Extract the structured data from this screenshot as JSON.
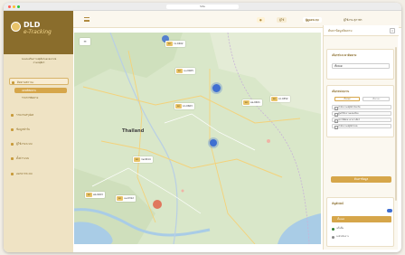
{
  "browser": {
    "address": "Site"
  },
  "brand": {
    "name": "DLD",
    "product": "e-Tracking"
  },
  "org": {
    "line1": "กองส่งเสริมการปศุสัตว์และสหกรณ์",
    "line2": "กรมปศุสัตว์"
  },
  "menu": [
    {
      "label": "ติดตามสถานะ",
      "active": true
    },
    {
      "label": "รายงานสรุปผล",
      "active": false
    },
    {
      "label": "ข้อมูลฟาร์ม",
      "active": false
    },
    {
      "label": "ผู้ใช้งานระบบ",
      "active": false
    },
    {
      "label": "ตั้งค่าระบบ",
      "active": false
    },
    {
      "label": "ออกจากระบบ",
      "active": false
    }
  ],
  "submenu": [
    {
      "label": "แผนที่ติดตาม",
      "active": true
    },
    {
      "label": "รายการติดตาม",
      "active": false
    }
  ],
  "topbar": {
    "notify": "ผู้ใช้",
    "role": "ผู้ดูแลระบบ",
    "user": "ผู้ใช้งาน สุภาพร"
  },
  "map": {
    "country_label": "Thailand",
    "layers_button": "≡",
    "markers": [
      {
        "tag": "ปศ.",
        "code": "กจ.0402"
      },
      {
        "tag": "ปศ.",
        "code": "นบ.0405"
      },
      {
        "tag": "ปศ.",
        "code": "ชร.0352"
      },
      {
        "tag": "ปศ.",
        "code": "พล.0401"
      },
      {
        "tag": "ปศ.",
        "code": "ขก.0603"
      },
      {
        "tag": "ปศ.",
        "code": "กพ.0414"
      },
      {
        "tag": "ปศ.",
        "code": "สค.0203"
      },
      {
        "tag": "ปศ.",
        "code": "นม.0312"
      }
    ]
  },
  "panel": {
    "title": "ค้นหาข้อมูลติดตาม",
    "close": "×",
    "filter1_title": "เลือกช่วงเวลาติดตาม",
    "filter1_value": "ทั้งหมด",
    "filter2_title": "เลือกหน่วยงาน",
    "filter2_tabs": [
      "ทั้งหมด",
      "เลือกเอง"
    ],
    "filter2_items": [
      "สำนักงานปศุสัตว์จังหวัด",
      "ศูนย์วิจัยการผสมเทียม",
      "สถานีพัฒนาอาหารสัตว์",
      "สำนักงานปศุสัตว์เขต"
    ],
    "search_button": "ค้นหาข้อมูล",
    "legend_title": "สัญลักษณ์",
    "legend_items": [
      "ทั้งหมด",
      "เสร็จสิ้น",
      "รอดำเนินการ"
    ]
  },
  "colors": {
    "gold": "#d6a64a",
    "brand_dark": "#8a6d2c",
    "sidebar": "#efe3c4",
    "cluster_blue": "#3f6fd1",
    "cluster_red": "#e0634a"
  }
}
